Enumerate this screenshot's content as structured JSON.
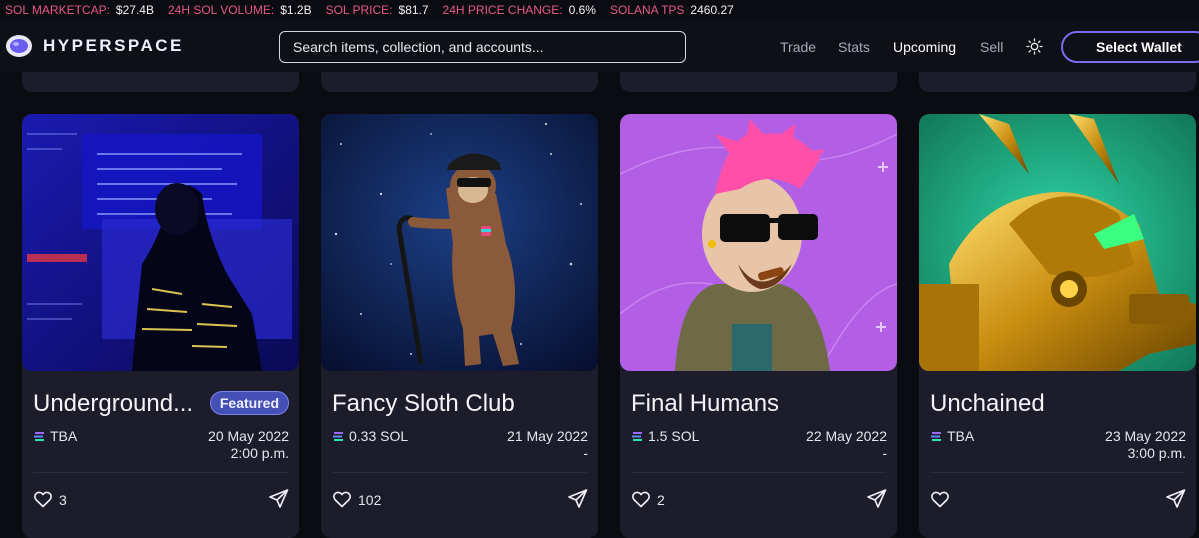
{
  "ticker": [
    {
      "label": "SOL MARKETCAP:",
      "value": "$27.4B"
    },
    {
      "label": "24H SOL VOLUME:",
      "value": "$1.2B"
    },
    {
      "label": "SOL PRICE:",
      "value": "$81.7"
    },
    {
      "label": "24H PRICE CHANGE:",
      "value": "0.6%"
    },
    {
      "label": "SOLANA TPS",
      "value": "2460.27"
    }
  ],
  "brand": {
    "name": "HYPERSPACE"
  },
  "search": {
    "placeholder": "Search items, collection, and accounts..."
  },
  "nav": {
    "trade": "Trade",
    "stats": "Stats",
    "upcoming": "Upcoming",
    "sell": "Sell",
    "wallet": "Select Wallet"
  },
  "icons": {
    "logo": "astronaut-helmet-icon",
    "theme": "sun-icon",
    "currency": "solana-icon",
    "like": "heart-icon",
    "share": "send-icon"
  },
  "colors": {
    "accent": "#7a6cf0",
    "ticker_label": "#e65a86",
    "card_bg": "#1c1c2b",
    "badge_bg": "#4450b5"
  },
  "cards": [
    {
      "title": "Underground...",
      "badge": "Featured",
      "price": "TBA",
      "date": "20 May 2022",
      "time": "2:00 p.m.",
      "likes": "3"
    },
    {
      "title": "Fancy Sloth Club",
      "price": "0.33 SOL",
      "date": "21 May 2022",
      "time": "-",
      "likes": "102"
    },
    {
      "title": "Final Humans",
      "price": "1.5 SOL",
      "date": "22 May 2022",
      "time": "-",
      "likes": "2"
    },
    {
      "title": "Unchained",
      "price": "TBA",
      "date": "23 May 2022",
      "time": "3:00 p.m.",
      "likes": ""
    }
  ]
}
